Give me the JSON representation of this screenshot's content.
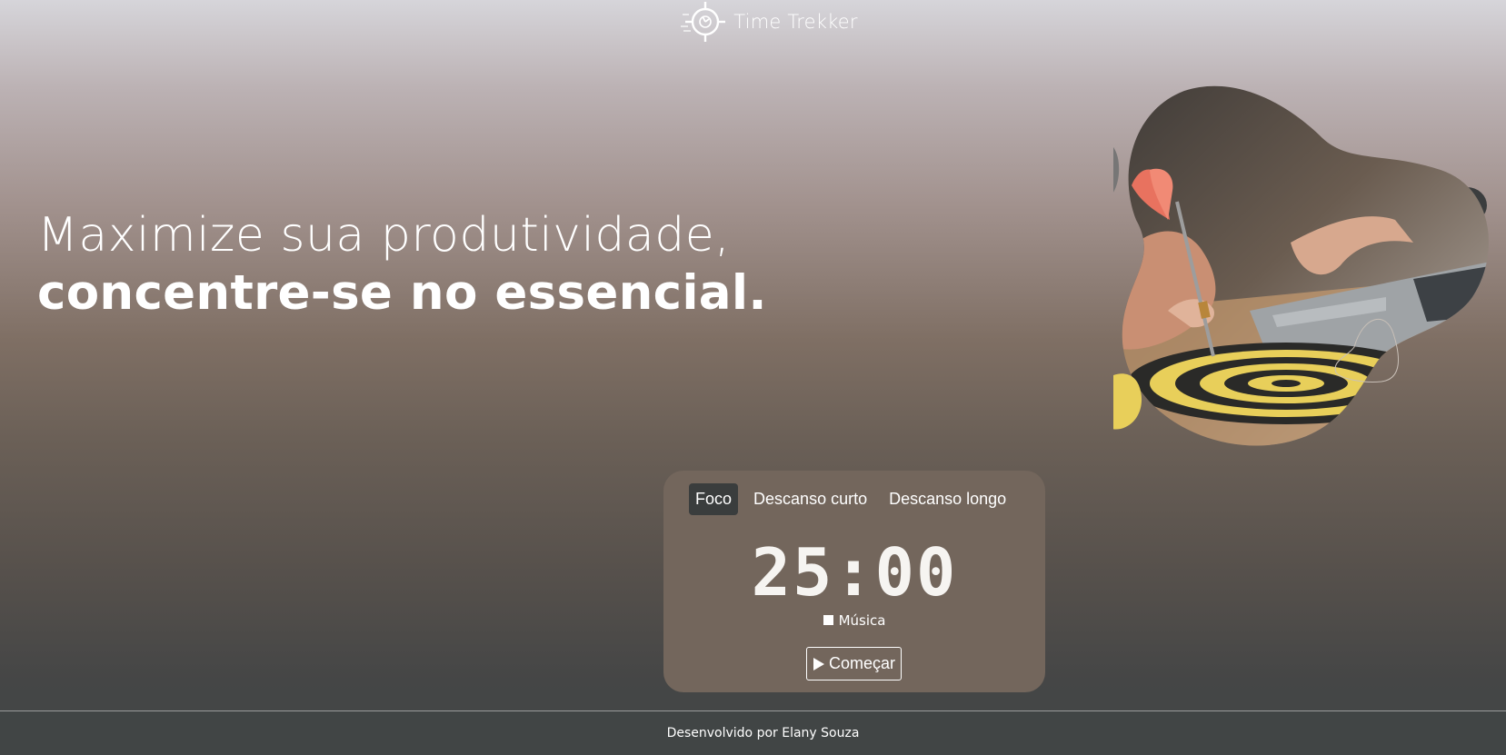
{
  "header": {
    "logo_text": "Time Trekker",
    "logo_icon": "clock-target-icon"
  },
  "hero": {
    "headline_line1": "Maximize sua produtividade,",
    "headline_line2": "concentre-se no essencial.",
    "image": "dart-hitting-target-illustration"
  },
  "timer": {
    "tabs": [
      {
        "label": "Foco",
        "active": true
      },
      {
        "label": "Descanso curto",
        "active": false
      },
      {
        "label": "Descanso longo",
        "active": false
      }
    ],
    "time": "25:00",
    "music_label": "Música",
    "music_checked": false,
    "start_label": "Começar",
    "start_icon": "play-icon"
  },
  "footer": {
    "credit": "Desenvolvido por Elany Souza"
  },
  "colors": {
    "card_bg": "#73665c",
    "active_tab_bg": "#3a3d3d",
    "footer_bg": "#414545",
    "accent_yellow": "#e8cf5a"
  }
}
